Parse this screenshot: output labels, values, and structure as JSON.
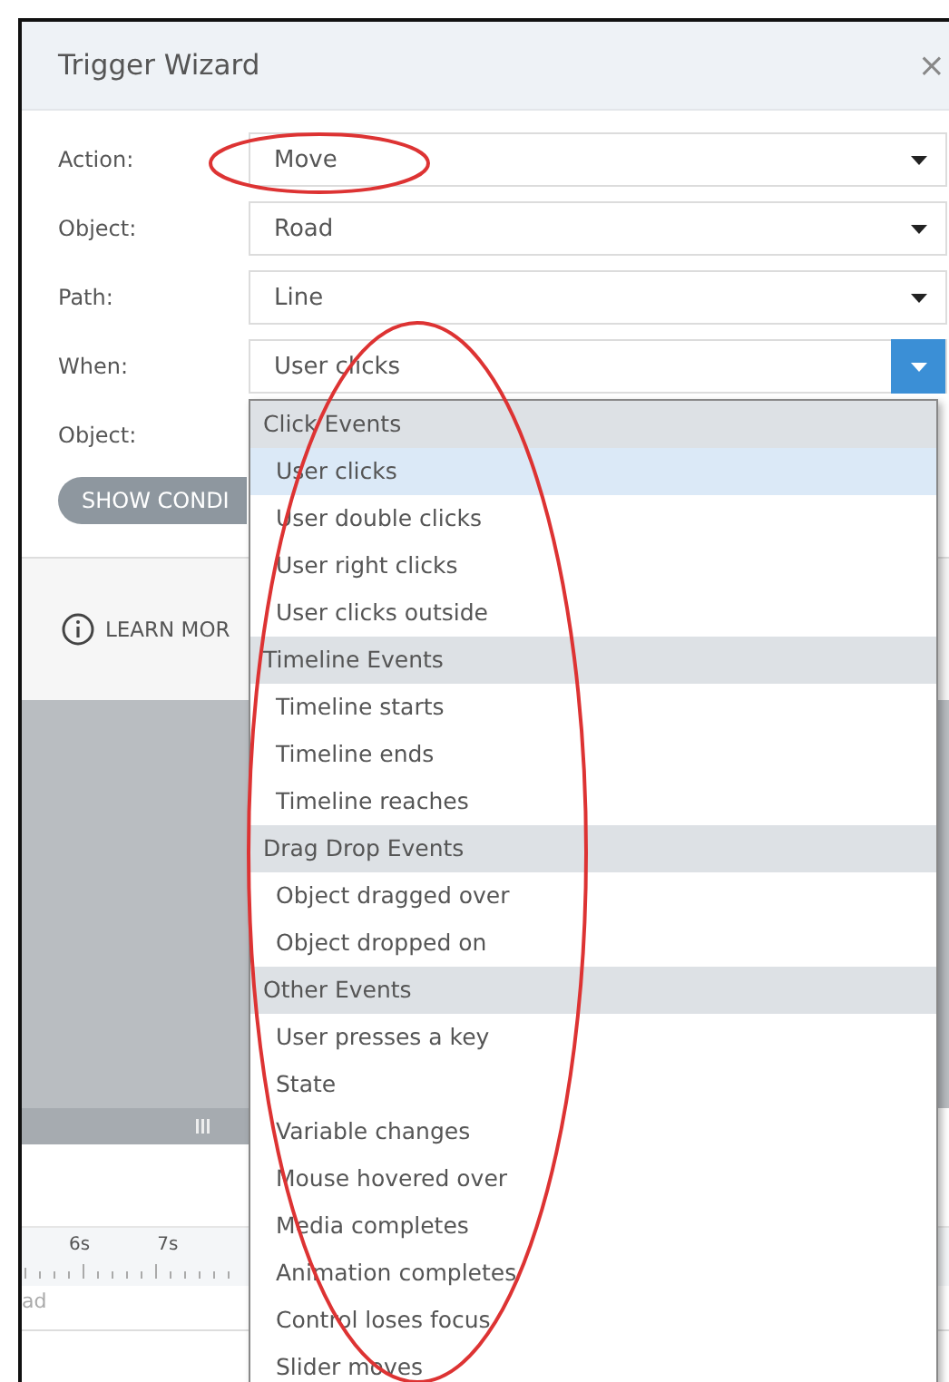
{
  "window": {
    "title": "Trigger Wizard",
    "close": "×"
  },
  "form": {
    "rows": [
      {
        "label": "Action:",
        "kind": "select",
        "value": "Move",
        "open": false
      },
      {
        "label": "Object:",
        "kind": "select",
        "value": "Road",
        "open": false
      },
      {
        "label": "Path:",
        "kind": "select",
        "value": "Line",
        "open": false
      },
      {
        "label": "When:",
        "kind": "select",
        "value": "User clicks",
        "open": true
      },
      {
        "label": "Object:",
        "kind": "label"
      }
    ]
  },
  "show_conditions_button": "SHOW CONDI",
  "learn_more": "LEARN MOR",
  "timeline": {
    "ticks": [
      "6s",
      "7s"
    ],
    "track_label": "ad"
  },
  "dropdown": {
    "groups": [
      {
        "heading": "Click Events",
        "items": [
          {
            "label": "User clicks",
            "selected": true
          },
          {
            "label": "User double clicks",
            "selected": false
          },
          {
            "label": "User right clicks",
            "selected": false
          },
          {
            "label": "User clicks outside",
            "selected": false
          }
        ]
      },
      {
        "heading": "Timeline Events",
        "items": [
          {
            "label": "Timeline starts",
            "selected": false
          },
          {
            "label": "Timeline ends",
            "selected": false
          },
          {
            "label": "Timeline reaches",
            "selected": false
          }
        ]
      },
      {
        "heading": "Drag Drop Events",
        "items": [
          {
            "label": "Object dragged over",
            "selected": false
          },
          {
            "label": "Object dropped on",
            "selected": false
          }
        ]
      },
      {
        "heading": "Other Events",
        "items": [
          {
            "label": "User presses a key",
            "selected": false
          },
          {
            "label": "State",
            "selected": false
          },
          {
            "label": "Variable changes",
            "selected": false
          },
          {
            "label": "Mouse hovered over",
            "selected": false
          },
          {
            "label": "Media completes",
            "selected": false
          },
          {
            "label": "Animation completes",
            "selected": false
          },
          {
            "label": "Control loses focus",
            "selected": false
          },
          {
            "label": "Slider moves",
            "selected": false
          }
        ]
      }
    ]
  }
}
